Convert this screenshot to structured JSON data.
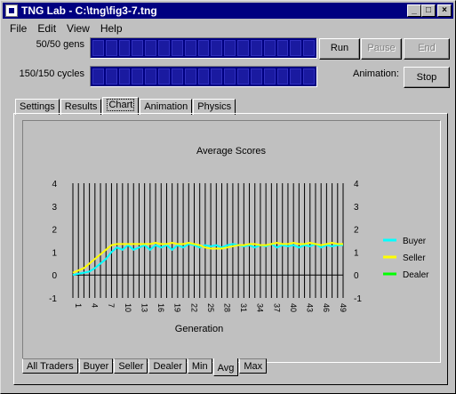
{
  "window": {
    "title": "TNG Lab - C:\\tng\\fig3-7.tng"
  },
  "menu": [
    "File",
    "Edit",
    "View",
    "Help"
  ],
  "progress": {
    "generations_label": "50/50 gens",
    "generations_fraction": 1.0,
    "cycles_label": "150/150 cycles",
    "cycles_fraction": 1.0
  },
  "controls": {
    "run": "Run",
    "pause": "Pause",
    "end": "End",
    "animation_label": "Animation:",
    "stop": "Stop"
  },
  "top_tabs": [
    "Settings",
    "Results",
    "Chart",
    "Animation",
    "Physics"
  ],
  "active_top_tab": "Chart",
  "bottom_tabs": [
    "All Traders",
    "Buyer",
    "Seller",
    "Dealer",
    "Min",
    "Avg",
    "Max"
  ],
  "active_bottom_tab": "Avg",
  "chart_data": {
    "type": "line",
    "title": "Average Scores",
    "xlabel": "Generation",
    "ylabel": "",
    "ylim": [
      -1,
      4
    ],
    "yticks": [
      4,
      3,
      2,
      1,
      0,
      -1
    ],
    "xticks": [
      "1",
      "4",
      "7",
      "10",
      "13",
      "16",
      "19",
      "22",
      "25",
      "28",
      "31",
      "34",
      "37",
      "40",
      "43",
      "46",
      "49"
    ],
    "grid": "vertical",
    "legend_position": "right",
    "x": [
      1,
      2,
      3,
      4,
      5,
      6,
      7,
      8,
      9,
      10,
      11,
      12,
      13,
      14,
      15,
      16,
      17,
      18,
      19,
      20,
      21,
      22,
      23,
      24,
      25,
      26,
      27,
      28,
      29,
      30,
      31,
      32,
      33,
      34,
      35,
      36,
      37,
      38,
      39,
      40,
      41,
      42,
      43,
      44,
      45,
      46,
      47,
      48,
      49,
      50
    ],
    "series": [
      {
        "name": "Buyer",
        "color": "#00ffff",
        "values": [
          0.0,
          0.05,
          0.1,
          0.15,
          0.3,
          0.5,
          0.7,
          1.0,
          1.2,
          1.1,
          1.3,
          1.1,
          1.2,
          1.3,
          1.1,
          1.3,
          1.2,
          1.3,
          1.1,
          1.3,
          1.2,
          1.35,
          1.3,
          1.2,
          1.3,
          1.25,
          1.3,
          1.2,
          1.3,
          1.35,
          1.3,
          1.25,
          1.3,
          1.2,
          1.3,
          1.25,
          1.35,
          1.2,
          1.3,
          1.25,
          1.3,
          1.2,
          1.3,
          1.25,
          1.35,
          1.2,
          1.3,
          1.25,
          1.3,
          1.3
        ]
      },
      {
        "name": "Seller",
        "color": "#ffff00",
        "values": [
          0.1,
          0.2,
          0.3,
          0.5,
          0.7,
          0.9,
          1.1,
          1.3,
          1.35,
          1.35,
          1.35,
          1.35,
          1.35,
          1.35,
          1.35,
          1.4,
          1.35,
          1.35,
          1.4,
          1.35,
          1.35,
          1.4,
          1.35,
          1.3,
          1.2,
          1.15,
          1.15,
          1.15,
          1.2,
          1.25,
          1.3,
          1.3,
          1.35,
          1.35,
          1.3,
          1.3,
          1.35,
          1.4,
          1.35,
          1.35,
          1.4,
          1.35,
          1.35,
          1.4,
          1.35,
          1.3,
          1.35,
          1.4,
          1.35,
          1.35
        ]
      },
      {
        "name": "Dealer",
        "color": "#00ff00",
        "values": []
      }
    ]
  }
}
